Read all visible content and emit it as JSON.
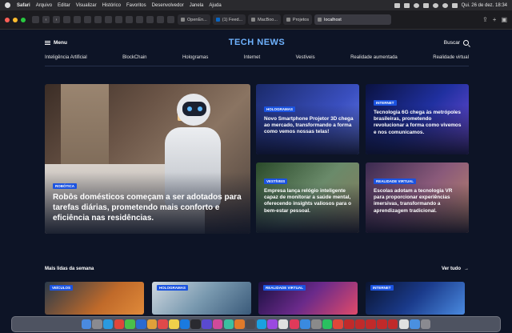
{
  "menubar": {
    "items": [
      "Safari",
      "Arquivo",
      "Editar",
      "Visualizar",
      "Histórico",
      "Favoritos",
      "Desenvolvedor",
      "Janela",
      "Ajuda"
    ],
    "clock": "Qui. 26 de dez.  18:34"
  },
  "browser": {
    "tabs": [
      "OpenEn...",
      "(1) Feed...",
      "MacBoo...",
      "Projetos"
    ],
    "url": "localhost"
  },
  "site": {
    "menu_label": "Menu",
    "logo": "TECH NEWS",
    "search_label": "Buscar",
    "categories": [
      "Inteligência Artificial",
      "BlockChain",
      "Hologramas",
      "Internet",
      "Vestíveis",
      "Realidade aumentada",
      "Realidade virtual"
    ],
    "hero": {
      "badge": "ROBÓTICA",
      "title": "Robôs domésticos começam a ser adotados para tarefas diárias, prometendo mais conforto e eficiência nas residências."
    },
    "cards": [
      {
        "badge": "HOLOGRAMAS",
        "title": "Novo Smartphone Projetor 3D chega ao mercado, transformando a forma como vemos nossas telas!"
      },
      {
        "badge": "INTERNET",
        "title": "Tecnologia 6G chega às metrópoles brasileiras, prometendo revolucionar a forma como vivemos e nos comunicamos."
      },
      {
        "badge": "VESTÍVEIS",
        "title": "Empresa lança relógio inteligente capaz de monitorar a saúde mental, oferecendo insights valiosos para o bem-estar pessoal."
      },
      {
        "badge": "REALIDADE VIRTUAL",
        "title": "Escolas adotam a tecnologia VR para proporcionar experiências imersivas, transformando a aprendizagem tradicional."
      }
    ],
    "section_title": "Mais lidas da semana",
    "see_all": "Ver tudo",
    "bottom_badges": [
      "VEÍCULOS",
      "HOLOGRAMAS",
      "REALIDADE VIRTUAL",
      "INTERNET"
    ]
  },
  "colors": {
    "accent": "#1b53e0",
    "logo": "#6fb3ff",
    "background": "#0d1426"
  }
}
